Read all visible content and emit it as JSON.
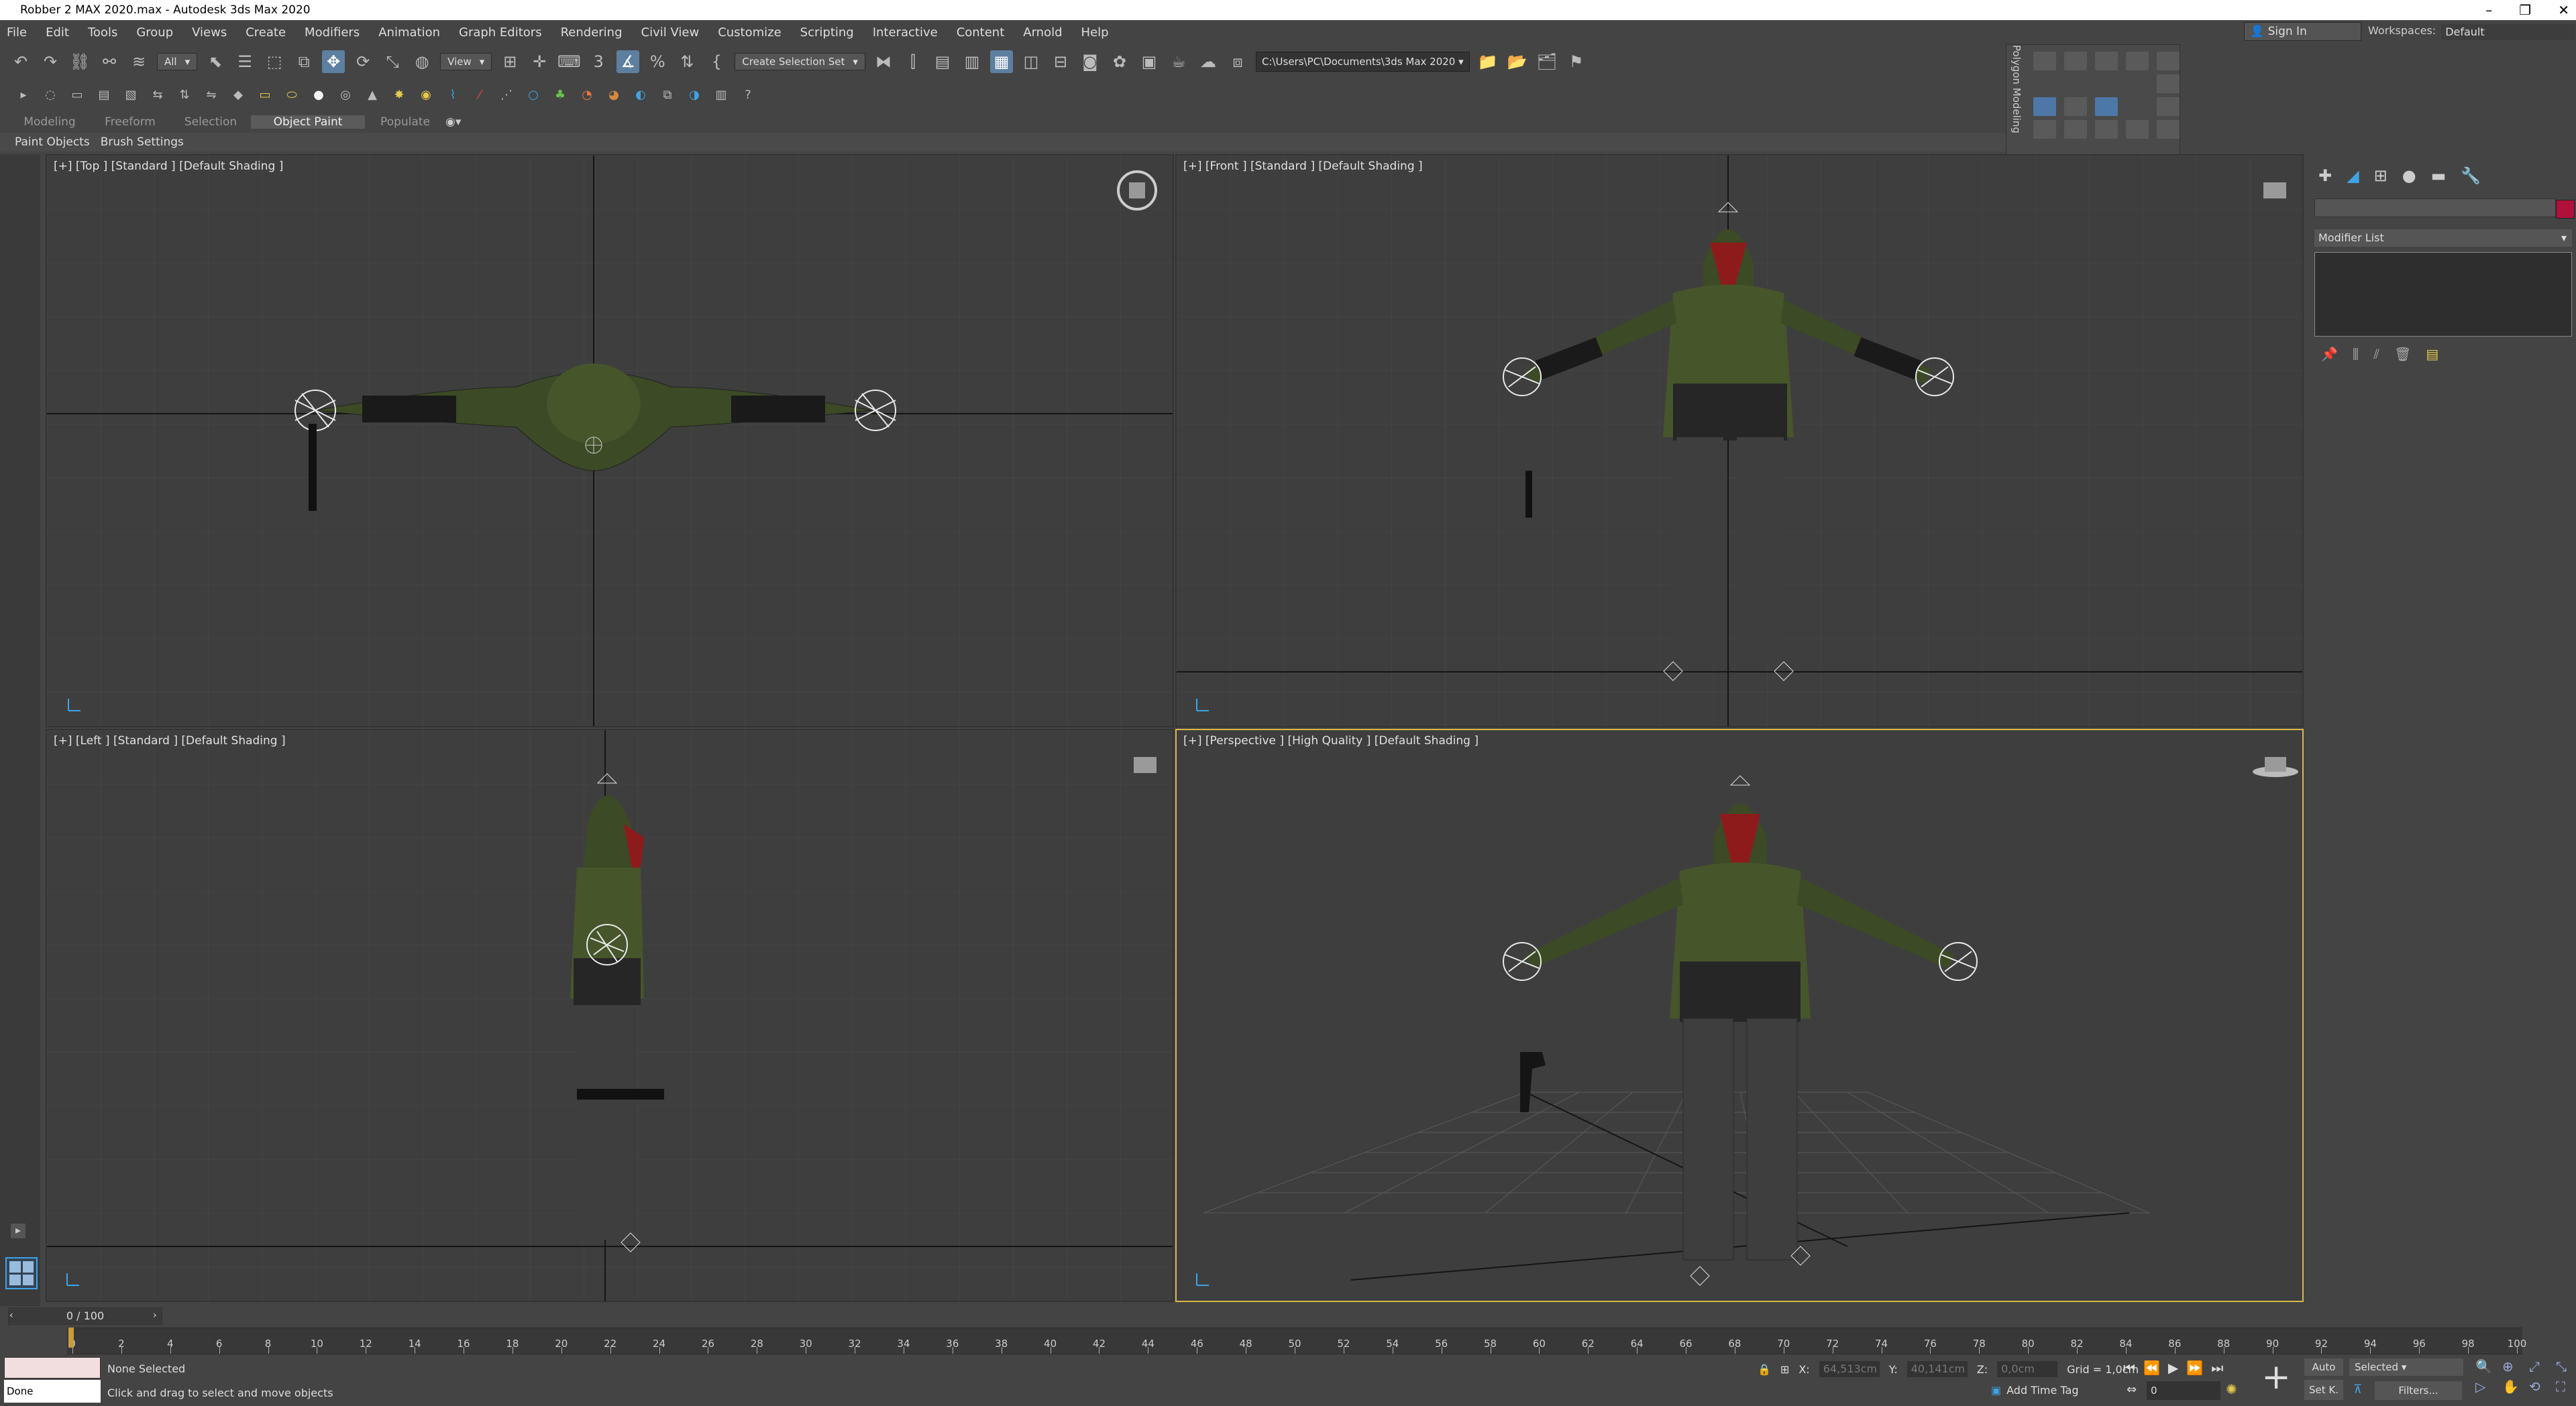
{
  "window": {
    "title": "Robber 2 MAX 2020.max - Autodesk 3ds Max 2020"
  },
  "menu": [
    "File",
    "Edit",
    "Tools",
    "Group",
    "Views",
    "Create",
    "Modifiers",
    "Animation",
    "Graph Editors",
    "Rendering",
    "Civil View",
    "Customize",
    "Scripting",
    "Interactive",
    "Content",
    "Arnold",
    "Help"
  ],
  "account": {
    "signin": "Sign In",
    "workspaces_label": "Workspaces:",
    "workspace": "Default"
  },
  "toolbar": {
    "filter": "All",
    "coord": "View",
    "selection_set": "Create Selection Set",
    "project_path": "C:\\Users\\PC\\Documents\\3ds Max 2020"
  },
  "ribbon": {
    "tabs": [
      "Modeling",
      "Freeform",
      "Selection",
      "Object Paint",
      "Populate"
    ],
    "active": "Object Paint",
    "subtabs": [
      "Paint Objects",
      "Brush Settings"
    ]
  },
  "polygon_modeling": "Polygon Modeling",
  "viewports": {
    "top": "[+] [Top ] [Standard ] [Default Shading ]",
    "front": "[+] [Front ] [Standard ] [Default Shading ]",
    "left": "[+] [Left ] [Standard ] [Default Shading ]",
    "perspective": "[+] [Perspective ] [High Quality ] [Default Shading ]"
  },
  "command_panel": {
    "modifier_list": "Modifier List",
    "color": "#b0103a"
  },
  "timeline": {
    "slider": "0 / 100",
    "ticks": [
      "0",
      "2",
      "4",
      "6",
      "8",
      "10",
      "12",
      "14",
      "16",
      "18",
      "20",
      "22",
      "24",
      "26",
      "28",
      "30",
      "32",
      "34",
      "36",
      "38",
      "40",
      "42",
      "44",
      "46",
      "48",
      "50",
      "52",
      "54",
      "56",
      "58",
      "60",
      "62",
      "64",
      "66",
      "68",
      "70",
      "72",
      "74",
      "76",
      "78",
      "80",
      "82",
      "84",
      "86",
      "88",
      "90",
      "92",
      "94",
      "96",
      "98",
      "100"
    ]
  },
  "status": {
    "selection": "None Selected",
    "prompt": "Click and drag to select and move objects",
    "done": "Done",
    "x_label": "X:",
    "x_val": "64,513cm",
    "y_label": "Y:",
    "y_val": "40,141cm",
    "z_label": "Z:",
    "z_val": "0,0cm",
    "grid": "Grid = 1,0cm",
    "add_time_tag": "Add Time Tag",
    "auto": "Auto",
    "set_key": "Set K.",
    "selected": "Selected",
    "filters": "Filters...",
    "frame": "0"
  },
  "colors": {
    "active_border": "#d8b84a",
    "accent": "#5d7fa0"
  }
}
